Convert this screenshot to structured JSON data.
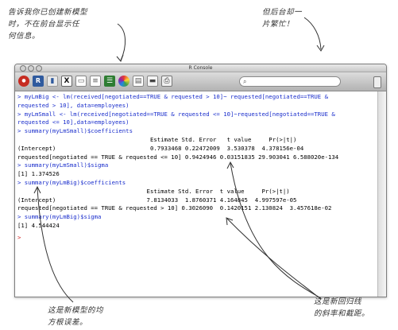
{
  "annotations": {
    "top_left": [
      "告诉我你已创建新模型",
      "时，不在前台显示任",
      "何信息。"
    ],
    "top_right": [
      "但后台却一",
      "片繁忙！"
    ],
    "bottom_left": [
      "这是新模型的均",
      "方根误差。"
    ],
    "bottom_right": [
      "这是新回归线",
      "的斜率和截距。"
    ]
  },
  "window": {
    "title": "R Console"
  },
  "toolbar": {
    "search_placeholder": "",
    "icons": [
      "stop-icon",
      "r-logo-icon",
      "chart-icon",
      "x11-icon",
      "new-document-icon",
      "source-file-icon",
      "workspace-list-icon",
      "color-wheel-icon",
      "document-icon",
      "folder-icon",
      "print-icon"
    ]
  },
  "console": {
    "lines": [
      {
        "kind": "in",
        "text": "> myLmBig <- lm(received[negotiated==TRUE & requested > 10]~ requested[negotiated==TRUE &"
      },
      {
        "kind": "in",
        "text": "requested > 10], data=employees)"
      },
      {
        "kind": "in",
        "text": "> myLmSmall <- lm(received[negotiated==TRUE & requested <= 10]~requested[negotiated==TRUE &"
      },
      {
        "kind": "in",
        "text": "requested <= 10],data=employees)"
      },
      {
        "kind": "in",
        "text": "> summary(myLmSmall)$coefficients"
      },
      {
        "kind": "out",
        "text": "                                      Estimate Std. Error   t value     Pr(>|t|)"
      },
      {
        "kind": "out",
        "text": "(Intercept)                           0.7933468 0.22472009  3.530378  4.378156e-04"
      },
      {
        "kind": "out",
        "text": "requested[negotiated == TRUE & requested <= 10] 0.9424946 0.03151835 29.903041 6.588020e-134"
      },
      {
        "kind": "in",
        "text": "> summary(myLmSmall)$sigma"
      },
      {
        "kind": "out",
        "text": "[1] 1.374526"
      },
      {
        "kind": "in",
        "text": "> summary(myLmBig)$coefficients"
      },
      {
        "kind": "out",
        "text": "                                     Estimate Std. Error  t value     Pr(>|t|)"
      },
      {
        "kind": "out",
        "text": "(Intercept)                          7.8134033  1.8760371 4.164845  4.997597e-05"
      },
      {
        "kind": "out",
        "text": "requested[negotiated == TRUE & requested > 10] 0.3026090  0.1420151 2.130824  3.457618e-02"
      },
      {
        "kind": "in",
        "text": "> summary(myLmBig)$sigma"
      },
      {
        "kind": "out",
        "text": "[1] 4.544424"
      },
      {
        "kind": "blank",
        "text": ""
      },
      {
        "kind": "prompt",
        "text": ">"
      }
    ]
  },
  "colors": {
    "input_text": "#1a2ecc",
    "output_text": "#000000",
    "annotation_text": "#333333"
  }
}
